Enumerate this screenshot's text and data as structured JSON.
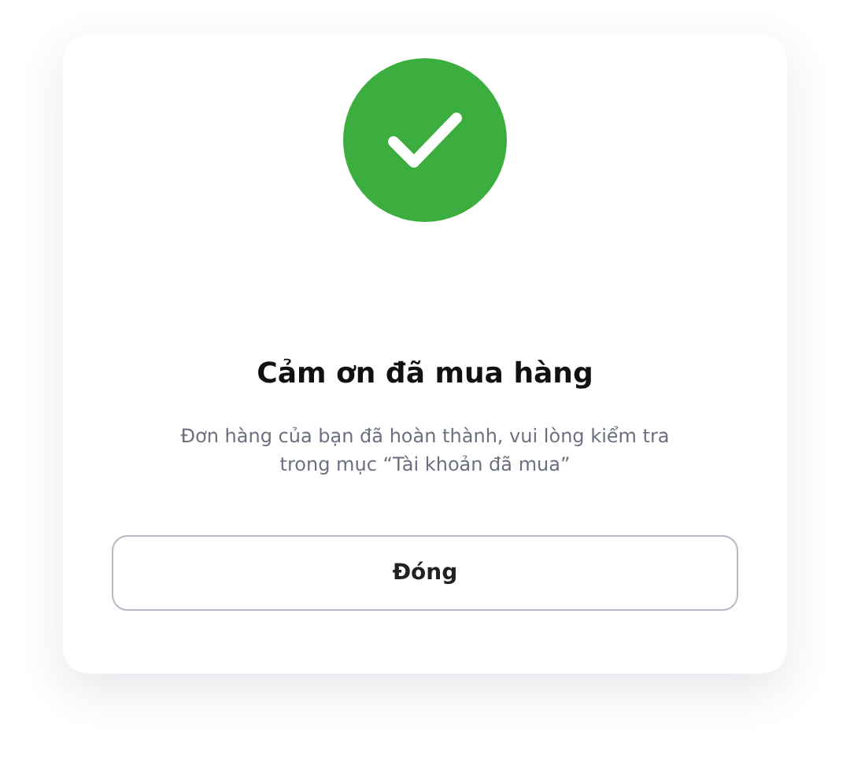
{
  "dialog": {
    "completed": true,
    "title": "Cảm ơn đã mua hàng",
    "message": "Đơn hàng của bạn đã hoàn thành, vui lòng kiểm tra trong mục “Tài khoản đã mua”",
    "buttons": [
      "Đóng"
    ]
  }
}
